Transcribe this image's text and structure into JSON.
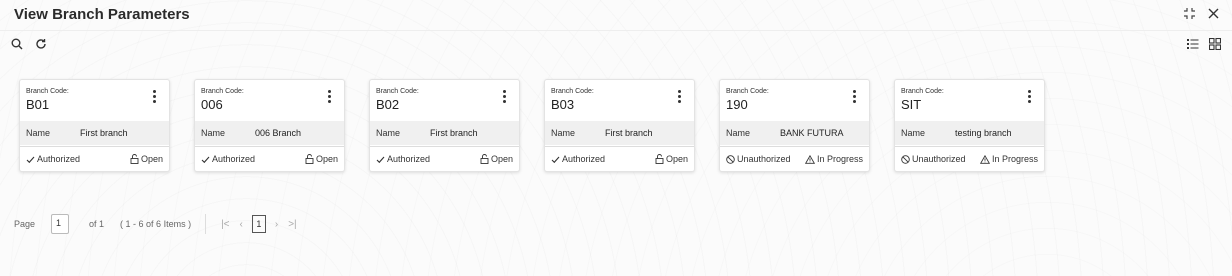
{
  "header": {
    "title": "View Branch Parameters",
    "expand_icon": "expand-icon",
    "close_icon": "close-icon"
  },
  "toolbar": {
    "search_icon": "search-icon",
    "refresh_icon": "refresh-icon",
    "list_view_icon": "list-view-icon",
    "grid_view_icon": "grid-view-icon"
  },
  "cards": [
    {
      "code_label": "Branch Code:",
      "code": "B01",
      "name_label": "Name",
      "name": "First branch",
      "auth": "Authorized",
      "auth_icon": "check-icon",
      "status": "Open",
      "status_icon": "lock-open-icon"
    },
    {
      "code_label": "Branch Code:",
      "code": "006",
      "name_label": "Name",
      "name": "006 Branch",
      "auth": "Authorized",
      "auth_icon": "check-icon",
      "status": "Open",
      "status_icon": "lock-open-icon"
    },
    {
      "code_label": "Branch Code:",
      "code": "B02",
      "name_label": "Name",
      "name": "First branch",
      "auth": "Authorized",
      "auth_icon": "check-icon",
      "status": "Open",
      "status_icon": "lock-open-icon"
    },
    {
      "code_label": "Branch Code:",
      "code": "B03",
      "name_label": "Name",
      "name": "First branch",
      "auth": "Authorized",
      "auth_icon": "check-icon",
      "status": "Open",
      "status_icon": "lock-open-icon"
    },
    {
      "code_label": "Branch Code:",
      "code": "190",
      "name_label": "Name",
      "name": "BANK FUTURA",
      "auth": "Unauthorized",
      "auth_icon": "ban-icon",
      "status": "In Progress",
      "status_icon": "warning-icon"
    },
    {
      "code_label": "Branch Code:",
      "code": "SIT",
      "name_label": "Name",
      "name": "testing branch",
      "auth": "Unauthorized",
      "auth_icon": "ban-icon",
      "status": "In Progress",
      "status_icon": "warning-icon"
    }
  ],
  "pagination": {
    "page_label": "Page",
    "page_value": "1",
    "of_text": "of 1",
    "items_text": "( 1 - 6 of 6 Items )",
    "current_page": "1"
  }
}
